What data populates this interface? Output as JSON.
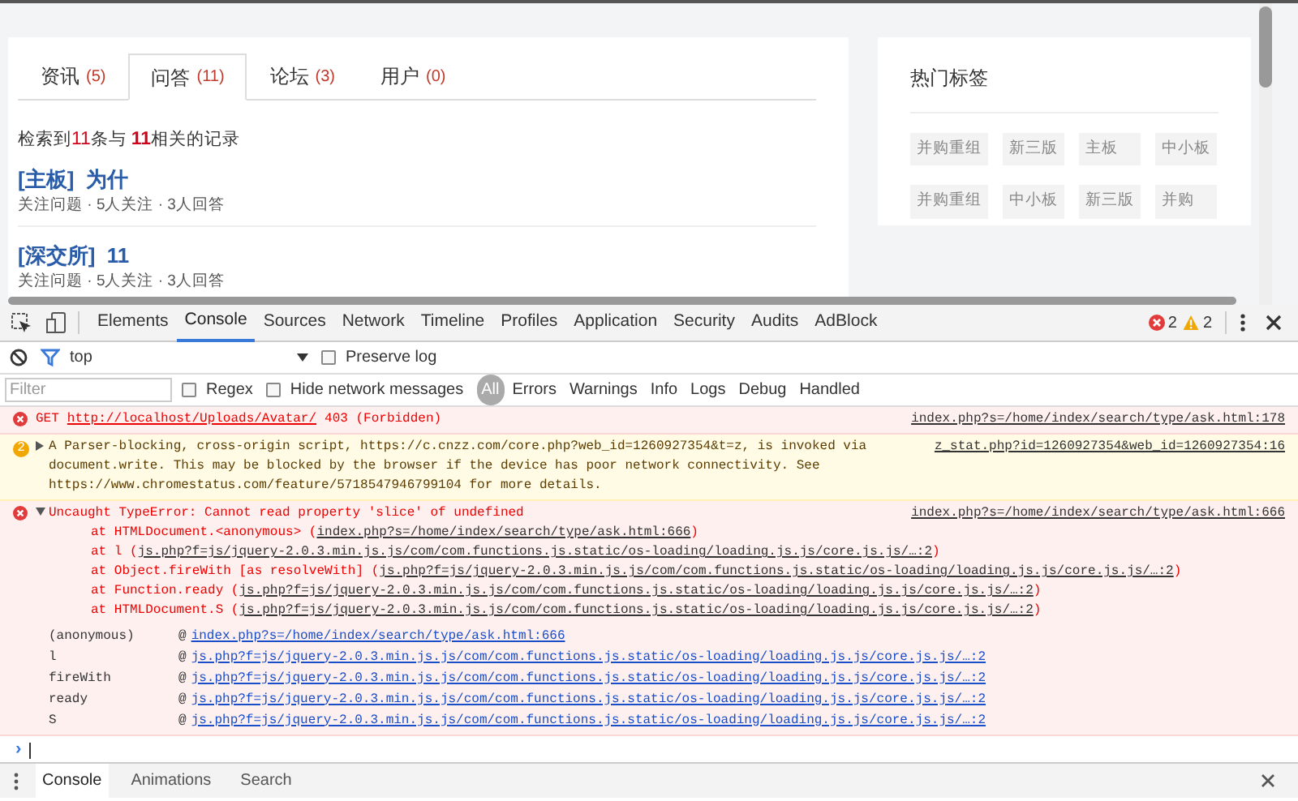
{
  "page": {
    "tabs": [
      {
        "label": "资讯",
        "count": "(5)",
        "selected": false
      },
      {
        "label": "问答",
        "count": "(11)",
        "selected": true
      },
      {
        "label": "论坛",
        "count": "(3)",
        "selected": false
      },
      {
        "label": "用户",
        "count": "(0)",
        "selected": false
      }
    ],
    "summary": [
      {
        "text": "检索到",
        "highlight": false
      },
      {
        "text": "11",
        "highlight": true
      },
      {
        "text": "条与 ",
        "highlight": false
      },
      {
        "text": "11",
        "highlight": true
      },
      {
        "text": "相关的记录",
        "highlight": false
      }
    ],
    "results": [
      {
        "title": "[主板]  为什",
        "meta": "关注问题 · 5人关注 · 3人回答"
      },
      {
        "title": "[深交所]  11",
        "meta": "关注问题 · 5人关注 · 3人回答"
      }
    ],
    "sidebar": {
      "title": "热门标签",
      "tags": [
        "并购重组",
        "新三版",
        "主板",
        "中小板",
        "并购重组",
        "中小板",
        "新三版",
        "并购"
      ]
    }
  },
  "devtools": {
    "tabs": [
      {
        "label": "Elements",
        "selected": false
      },
      {
        "label": "Console",
        "selected": true
      },
      {
        "label": "Sources",
        "selected": false
      },
      {
        "label": "Network",
        "selected": false
      },
      {
        "label": "Timeline",
        "selected": false
      },
      {
        "label": "Profiles",
        "selected": false
      },
      {
        "label": "Application",
        "selected": false
      },
      {
        "label": "Security",
        "selected": false
      },
      {
        "label": "Audits",
        "selected": false
      },
      {
        "label": "AdBlock",
        "selected": false
      }
    ],
    "error_count": "2",
    "warning_count": "2",
    "context": "top",
    "preserve_log": {
      "label": "Preserve log",
      "checked": false
    },
    "filter": {
      "placeholder": "Filter"
    },
    "regex": {
      "label": "Regex",
      "checked": false
    },
    "hide_network": {
      "label": "Hide network messages",
      "checked": false
    },
    "levels": [
      {
        "label": "All",
        "selected": true
      },
      {
        "label": "Errors",
        "selected": false
      },
      {
        "label": "Warnings",
        "selected": false
      },
      {
        "label": "Info",
        "selected": false
      },
      {
        "label": "Logs",
        "selected": false
      },
      {
        "label": "Debug",
        "selected": false
      },
      {
        "label": "Handled",
        "selected": false
      }
    ],
    "messages": [
      {
        "kind": "error",
        "prefix": "GET",
        "url": "http://localhost/Uploads/Avatar/",
        "text": "403 (Forbidden)",
        "source": "index.php?s=/home/index/search/type/ask.html:178"
      },
      {
        "kind": "warning",
        "repeat": "2",
        "expanded": false,
        "text": "A Parser-blocking, cross-origin script, https://c.cnzz.com/core.php?web_id=1260927354&t=z, is invoked via document.write. This may be blocked by the browser if the device has poor network connectivity. See https://www.chromestatus.com/feature/5718547946799104 for more details.",
        "source": "z_stat.php?id=1260927354&web_id=1260927354:16"
      },
      {
        "kind": "error",
        "expanded": true,
        "text": "Uncaught TypeError: Cannot read property 'slice' of undefined",
        "source": "index.php?s=/home/index/search/type/ask.html:666",
        "stack": [
          {
            "at": "at HTMLDocument.<anonymous> (",
            "link": "index.php?s=/home/index/search/type/ask.html:666",
            "end": ")"
          },
          {
            "at": "at l (",
            "link": "js.php?f=js/jquery-2.0.3.min.js.js/com/com.functions.js.static/os-loading/loading.js.js/core.js.js/…:2",
            "end": ")"
          },
          {
            "at": "at Object.fireWith [as resolveWith] (",
            "link": "js.php?f=js/jquery-2.0.3.min.js.js/com/com.functions.js.static/os-loading/loading.js.js/core.js.js/…:2",
            "end": ")"
          },
          {
            "at": "at Function.ready (",
            "link": "js.php?f=js/jquery-2.0.3.min.js.js/com/com.functions.js.static/os-loading/loading.js.js/core.js.js/…:2",
            "end": ")"
          },
          {
            "at": "at HTMLDocument.S (",
            "link": "js.php?f=js/jquery-2.0.3.min.js.js/com/com.functions.js.static/os-loading/loading.js.js/core.js.js/…:2",
            "end": ")"
          }
        ],
        "frames": [
          {
            "fn": "(anonymous)",
            "at_sign": "@",
            "link": "index.php?s=/home/index/search/type/ask.html:666"
          },
          {
            "fn": "l",
            "at_sign": "@",
            "link": "js.php?f=js/jquery-2.0.3.min.js.js/com/com.functions.js.static/os-loading/loading.js.js/core.js.js/…:2"
          },
          {
            "fn": "fireWith",
            "at_sign": "@",
            "link": "js.php?f=js/jquery-2.0.3.min.js.js/com/com.functions.js.static/os-loading/loading.js.js/core.js.js/…:2"
          },
          {
            "fn": "ready",
            "at_sign": "@",
            "link": "js.php?f=js/jquery-2.0.3.min.js.js/com/com.functions.js.static/os-loading/loading.js.js/core.js.js/…:2"
          },
          {
            "fn": "S",
            "at_sign": "@",
            "link": "js.php?f=js/jquery-2.0.3.min.js.js/com/com.functions.js.static/os-loading/loading.js.js/core.js.js/…:2"
          }
        ]
      }
    ],
    "prompt": "›",
    "drawer_tabs": [
      {
        "label": "Console",
        "selected": true
      },
      {
        "label": "Animations",
        "selected": false
      },
      {
        "label": "Search",
        "selected": false
      }
    ]
  }
}
